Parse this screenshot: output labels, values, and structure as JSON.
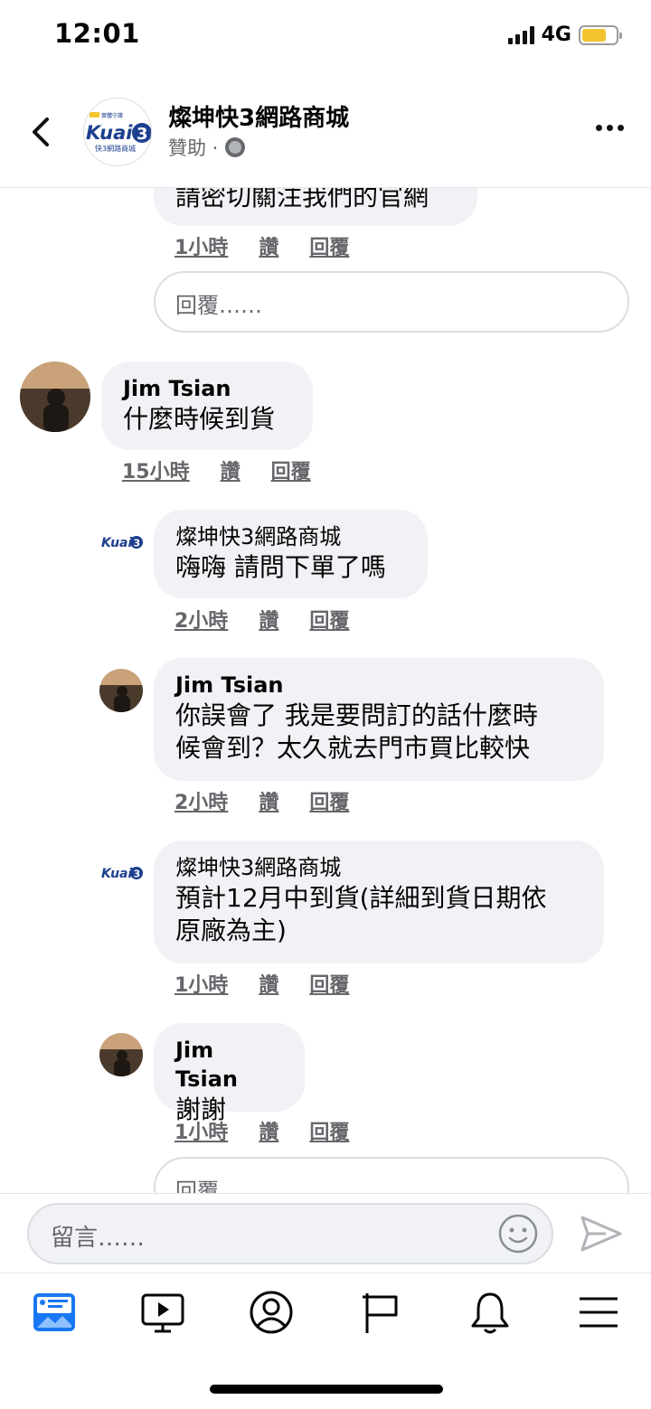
{
  "status_bar": {
    "time": "12:01",
    "network": "4G"
  },
  "header": {
    "page_name": "燦坤快3網路商城",
    "sponsored": "贊助 ·"
  },
  "comments": {
    "top_partial_text": "請密切關注我們的官網",
    "top_meta": {
      "time": "1小時",
      "like": "讚",
      "reply": "回覆"
    },
    "reply_placeholder": "回覆……",
    "c1": {
      "name": "Jim Tsian",
      "text": "什麼時候到貨",
      "time": "15小時",
      "like": "讚",
      "reply": "回覆"
    },
    "r1": {
      "name": "燦坤快3網路商城",
      "text": "嗨嗨 請問下單了嗎",
      "time": "2小時",
      "like": "讚",
      "reply": "回覆"
    },
    "r2": {
      "name": "Jim Tsian",
      "text_line1": "你誤會了  我是要問訂的話什麼時",
      "text_line2": "候會到？太久就去門市買比較快",
      "time": "2小時",
      "like": "讚",
      "reply": "回覆"
    },
    "r3": {
      "name": "燦坤快3網路商城",
      "text_line1": "預計12月中到貨(詳細到貨日期依",
      "text_line2": "原廠為主)",
      "time": "1小時",
      "like": "讚",
      "reply": "回覆"
    },
    "r4": {
      "name": "Jim Tsian",
      "text": "謝謝",
      "time": "1小時",
      "like": "讚",
      "reply": "回覆"
    },
    "bottom_reply_placeholder": "回覆……"
  },
  "comment_bar": {
    "placeholder": "留言……"
  },
  "logo": {
    "top_badge": "實體守護",
    "brand": "Kuai",
    "number": "3",
    "tagline": "快3網路商城"
  },
  "bottom_nav": {
    "icons": [
      "news-feed-icon",
      "watch-icon",
      "profile-icon",
      "pages-flag-icon",
      "notifications-bell-icon",
      "menu-icon"
    ]
  },
  "colors": {
    "accent": "#1877f2",
    "bubble": "#f0f2f5",
    "secondary_text": "#65676b",
    "battery": "#f4c430"
  }
}
